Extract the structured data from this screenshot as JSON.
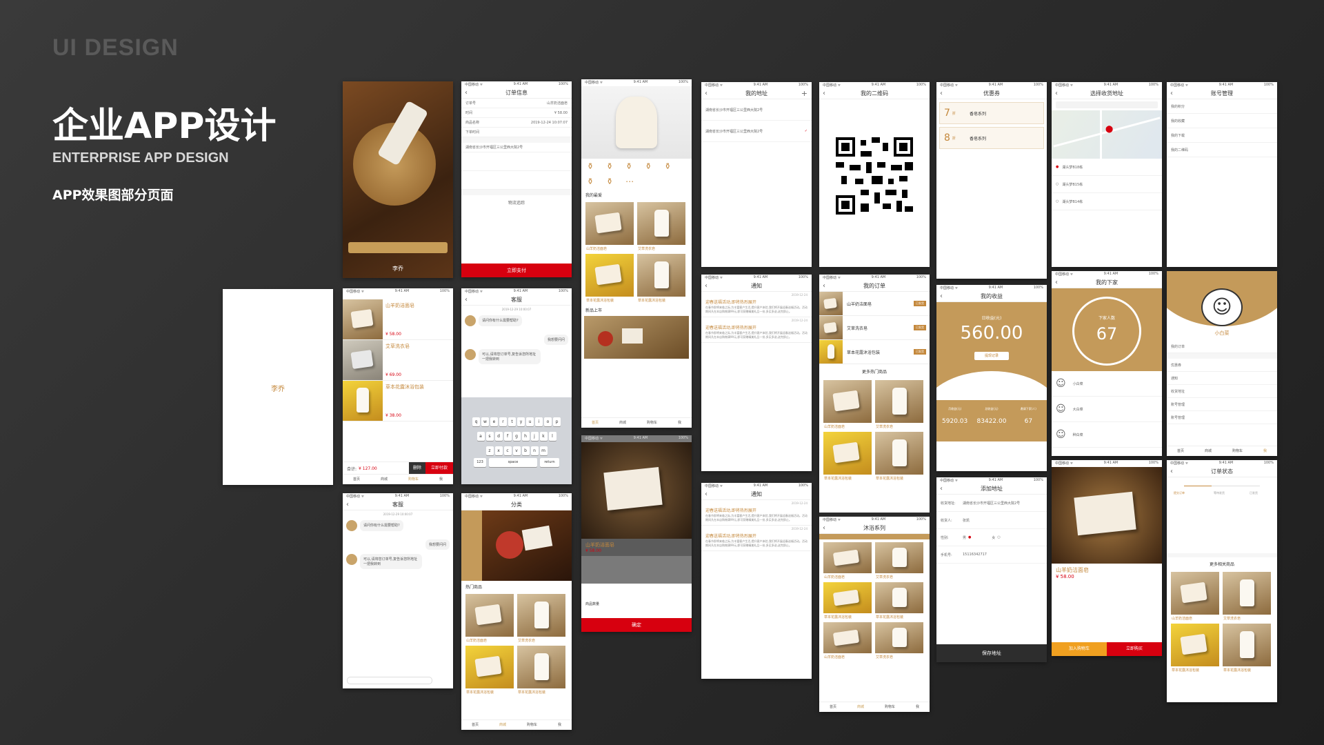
{
  "header": {
    "ui_design": "UI DESIGN",
    "title": "企业APP设计",
    "subtitle": "ENTERPRISE APP DESIGN",
    "description": "APP效果图部分页面"
  },
  "status": {
    "carrier": "中国移动 ᯤ",
    "time": "9:41 AM",
    "battery": "100%"
  },
  "tabs": [
    "首页",
    "商城",
    "购物车",
    "我"
  ],
  "splash": {
    "brand": "李乔"
  },
  "order_info": {
    "title": "订单信息",
    "rows": [
      "订单号",
      "时间",
      "商品名称",
      "下单时间"
    ],
    "values": [
      "山羊奶洁面皂",
      "¥ 58.00",
      "2019-12-24 10:07:07"
    ],
    "address": "湖南省长沙市开福区三公里西大院2号",
    "track": "物流追踪",
    "pay_button": "立即支付"
  },
  "home": {
    "section1": "我的最爱",
    "section2": "新品上市"
  },
  "address_list": {
    "title": "我的地址",
    "items": [
      "湖南省长沙市开福区三公里西大院2号",
      "湖南省长沙市开福区三公里西大院2号"
    ]
  },
  "qr": {
    "title": "我的二维码"
  },
  "coupon": {
    "title": "优惠券",
    "items": [
      {
        "amount": "7",
        "unit": "折",
        "name": "香皂系列"
      },
      {
        "amount": "8",
        "unit": "折",
        "name": "香皂系列"
      }
    ]
  },
  "select_address": {
    "title": "选择收货地址",
    "items": [
      "湖头梦B18栋",
      "湖头梦B15栋",
      "湖头梦B14栋"
    ]
  },
  "account": {
    "title": "账号管理",
    "items": [
      "我的积分",
      "我的收藏",
      "我的下载",
      "我的二维码"
    ]
  },
  "cart": {
    "items": [
      {
        "name": "山羊奶洁面皂",
        "price": "¥ 58.00"
      },
      {
        "name": "艾草洗衣皂",
        "price": "¥ 69.00"
      },
      {
        "name": "草本花露沐浴包装",
        "price": "¥ 38.00"
      }
    ],
    "total_label": "合计:",
    "total": "¥ 127.00",
    "delete": "删除",
    "checkout": "立即付款"
  },
  "service": {
    "title": "客服",
    "date": "2019-12-29 10:00:07",
    "msg1": "请问你有什么需要帮助?",
    "msg2": "我想要问问",
    "msg3": "可以,请将您订单号,复告诉您所地址一把我转到",
    "kb_row1": [
      "q",
      "w",
      "e",
      "r",
      "t",
      "y",
      "u",
      "i",
      "o",
      "p"
    ],
    "kb_row2": [
      "a",
      "s",
      "d",
      "f",
      "g",
      "h",
      "j",
      "k",
      "l"
    ],
    "kb_row3": [
      "z",
      "x",
      "c",
      "v",
      "b",
      "n",
      "m"
    ],
    "space": "space",
    "return": "return",
    "num": "123"
  },
  "notification": {
    "title": "通知",
    "heading": "迎春送福活动,即将热烈展开",
    "date": "2019-12-24",
    "body": "在春节即将来临之际,为丰富客户生活,提升客户体验,我们将开展迎春送福活动。活动期间凡在本店购物满99元,即可获赠精美礼品一份,多买多送,送完即止。"
  },
  "my_orders": {
    "title": "我的订单",
    "items": [
      "山羊奶洁面皂",
      "艾草洗衣皂",
      "草本花露沐浴包装"
    ],
    "badge": "已发货",
    "more": "更多热门商品"
  },
  "earnings": {
    "title": "我的收益",
    "today_label": "日收益(元)",
    "today": "560.00",
    "button": "提现记录",
    "stats": [
      {
        "label": "月收益(元)",
        "value": "5920.03"
      },
      {
        "label": "总收益(元)",
        "value": "83422.00"
      },
      {
        "label": "邀请下家(人)",
        "value": "67"
      }
    ]
  },
  "downline": {
    "title": "我的下家",
    "label": "下家人数",
    "count": "67",
    "names": [
      "小白菜",
      "大白菜",
      "种白菜"
    ]
  },
  "profile": {
    "name": "小白菜",
    "items": [
      "我的订单",
      "优惠券",
      "通知",
      "收货地址",
      "账号管理",
      "账号管理"
    ]
  },
  "product_detail": {
    "name": "山羊奶洁面皂",
    "price": "¥ 58.00",
    "qty_label": "商品数量",
    "confirm": "确定"
  },
  "add_address": {
    "title": "添加地址",
    "labels": [
      "收货地址:",
      "收货人:",
      "性别:",
      "手机号:"
    ],
    "address": "湖南省长沙市开福区三公里西大院2号",
    "person": "张凯",
    "male": "男",
    "female": "女",
    "phone": "15116342717",
    "save": "保存地址"
  },
  "body_series": {
    "title": "沐浴系列"
  },
  "category": {
    "title": "分类",
    "section": "热门商品"
  },
  "detail_page": {
    "name": "山羊奶洁面皂",
    "price": "¥ 58.00",
    "add_cart": "加入购物车",
    "buy_now": "立即购买"
  },
  "order_status": {
    "title": "订单状态",
    "steps": [
      "提交订单",
      "等待发货",
      "已发货"
    ],
    "more": "更多相关商品"
  },
  "product_names": [
    "山羊奶洁面皂",
    "艾草洗衣皂",
    "草本花露沐浴包装",
    "草本花露沐浴包装"
  ]
}
